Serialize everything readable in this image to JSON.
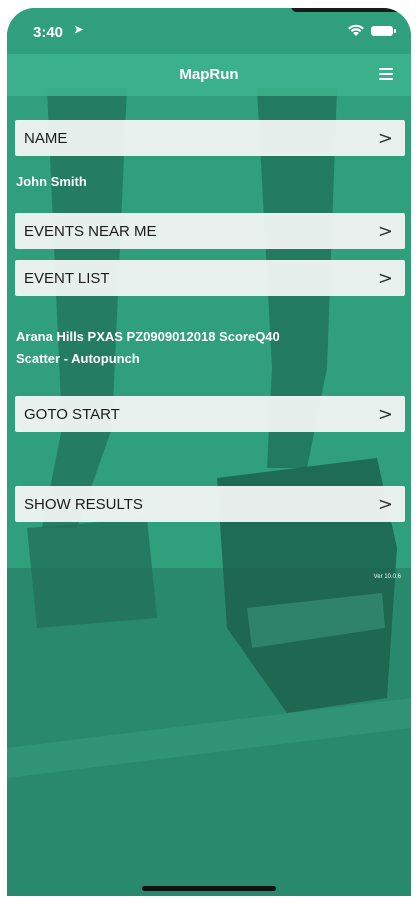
{
  "status": {
    "time": "3:40"
  },
  "navbar": {
    "title": "MapRun"
  },
  "name_row": {
    "label": "NAME",
    "value": "John Smith"
  },
  "events_near_me": {
    "label": "EVENTS NEAR ME"
  },
  "event_list": {
    "label": "EVENT LIST"
  },
  "selected_event": {
    "line1": "Arana Hills PXAS PZ0909012018 ScoreQ40",
    "line2": "Scatter - Autopunch"
  },
  "goto_start": {
    "label": "GOTO START"
  },
  "show_results": {
    "label": "SHOW RESULTS"
  },
  "version": "Ver 10.0.6",
  "chevron": ">",
  "colors": {
    "accent": "#35a985",
    "row_bg": "#f2f6f4",
    "text_dark": "#1c1c1c"
  },
  "icons": {
    "status": [
      "location-arrow-icon",
      "wifi-icon",
      "battery-icon"
    ],
    "nav": "menu-icon"
  }
}
